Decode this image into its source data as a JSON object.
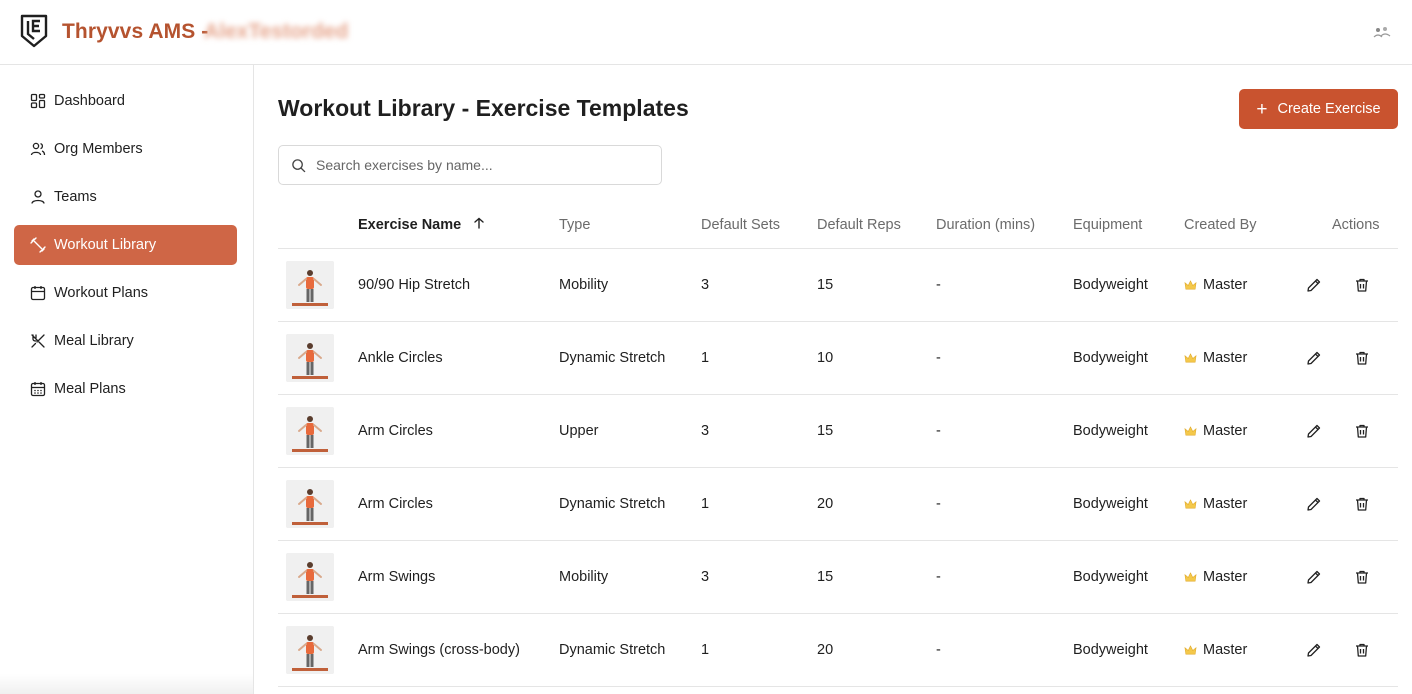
{
  "header": {
    "app_title": "Thryvvs AMS -",
    "org_name": "AlexTestorded"
  },
  "sidebar": {
    "items": [
      {
        "label": "Dashboard",
        "icon": "dashboard-icon",
        "active": false
      },
      {
        "label": "Org Members",
        "icon": "users-icon",
        "active": false
      },
      {
        "label": "Teams",
        "icon": "user-icon",
        "active": false
      },
      {
        "label": "Workout Library",
        "icon": "dumbbell-icon",
        "active": true
      },
      {
        "label": "Workout Plans",
        "icon": "calendar-icon",
        "active": false
      },
      {
        "label": "Meal Library",
        "icon": "utensils-icon",
        "active": false
      },
      {
        "label": "Meal Plans",
        "icon": "calendar-days-icon",
        "active": false
      }
    ]
  },
  "main": {
    "title": "Workout Library - Exercise Templates",
    "create_button": "Create Exercise",
    "search_placeholder": "Search exercises by name..."
  },
  "table": {
    "columns": [
      "Exercise Name",
      "Type",
      "Default Sets",
      "Default Reps",
      "Duration (mins)",
      "Equipment",
      "Created By",
      "Actions"
    ],
    "sort_column": "Exercise Name",
    "sort_direction": "ascending",
    "rows": [
      {
        "name": "90/90 Hip Stretch",
        "type": "Mobility",
        "sets": "3",
        "reps": "15",
        "duration": "-",
        "equipment": "Bodyweight",
        "created_by": "Master"
      },
      {
        "name": "Ankle Circles",
        "type": "Dynamic Stretch",
        "sets": "1",
        "reps": "10",
        "duration": "-",
        "equipment": "Bodyweight",
        "created_by": "Master"
      },
      {
        "name": "Arm Circles",
        "type": "Upper",
        "sets": "3",
        "reps": "15",
        "duration": "-",
        "equipment": "Bodyweight",
        "created_by": "Master"
      },
      {
        "name": "Arm Circles",
        "type": "Dynamic Stretch",
        "sets": "1",
        "reps": "20",
        "duration": "-",
        "equipment": "Bodyweight",
        "created_by": "Master"
      },
      {
        "name": "Arm Swings",
        "type": "Mobility",
        "sets": "3",
        "reps": "15",
        "duration": "-",
        "equipment": "Bodyweight",
        "created_by": "Master"
      },
      {
        "name": "Arm Swings (cross-body)",
        "type": "Dynamic Stretch",
        "sets": "1",
        "reps": "20",
        "duration": "-",
        "equipment": "Bodyweight",
        "created_by": "Master"
      }
    ]
  },
  "colors": {
    "brand": "#b5532f",
    "active_nav": "#cf6646",
    "primary_button": "#c9532f"
  }
}
